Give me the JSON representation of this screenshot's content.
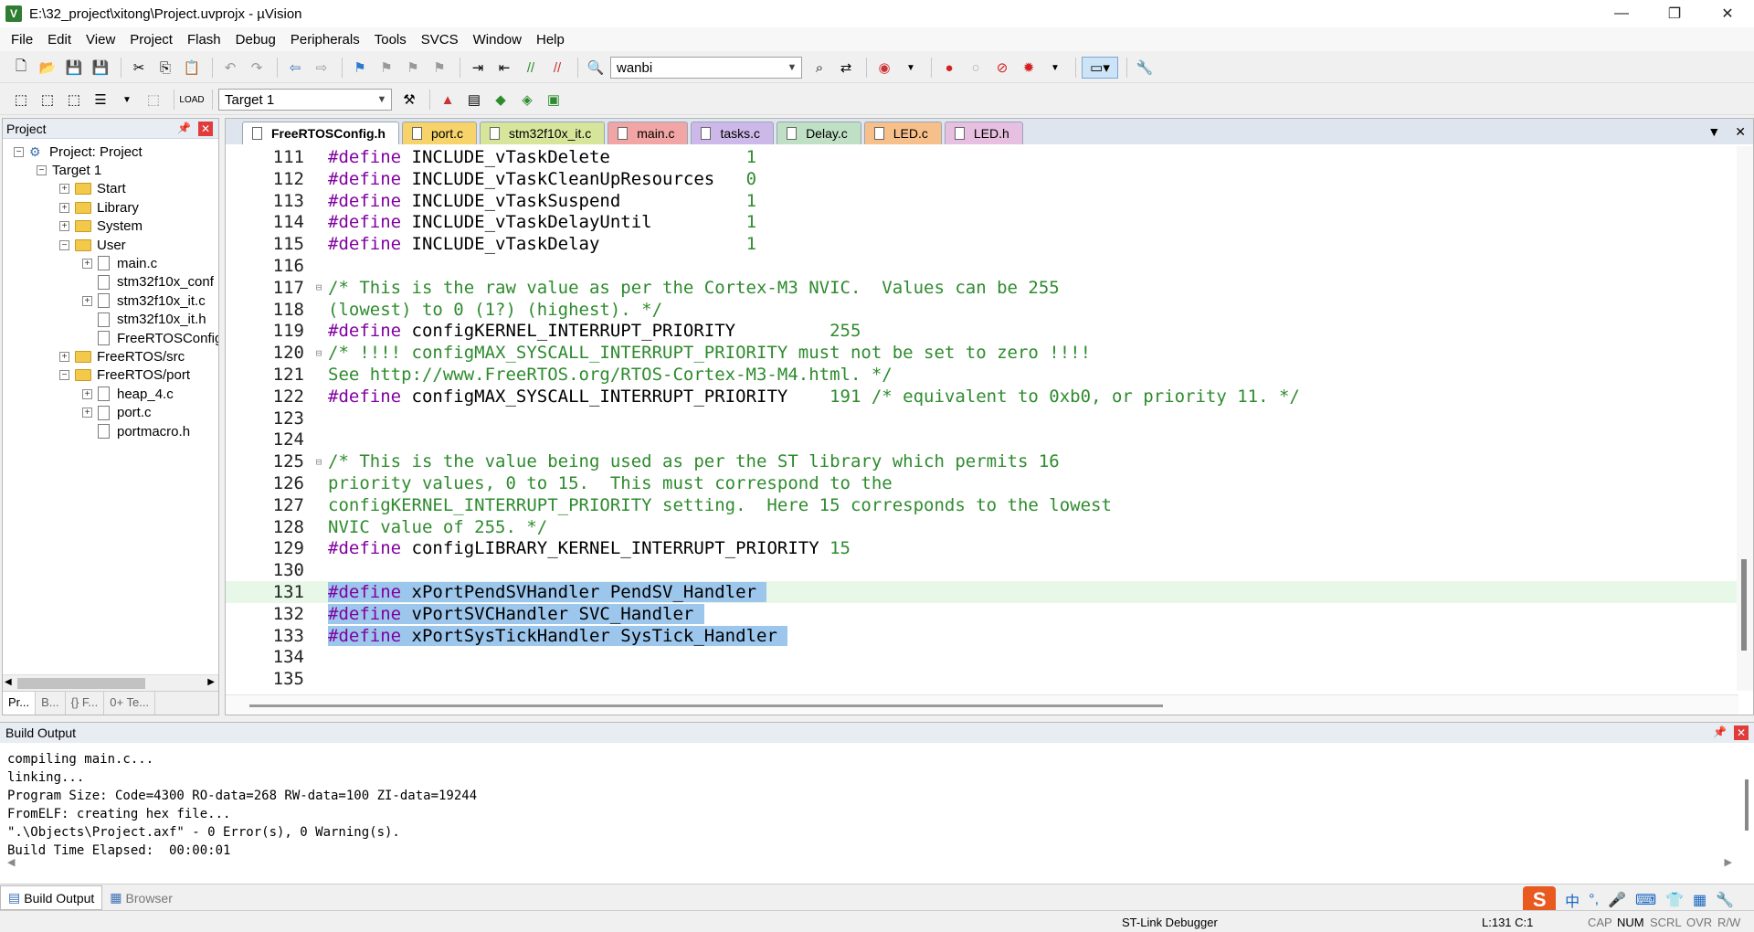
{
  "window": {
    "title": "E:\\32_project\\xitong\\Project.uvprojx - µVision",
    "minimize": "—",
    "maximize": "❐",
    "close": "✕"
  },
  "menu": [
    "File",
    "Edit",
    "View",
    "Project",
    "Flash",
    "Debug",
    "Peripherals",
    "Tools",
    "SVCS",
    "Window",
    "Help"
  ],
  "toolbar": {
    "find_value": "wanbi",
    "target_value": "Target 1"
  },
  "project_panel": {
    "title": "Project",
    "nodes": [
      {
        "label": "Project: Project",
        "level": 0,
        "type": "project",
        "exp": "−"
      },
      {
        "label": "Target 1",
        "level": 1,
        "type": "target",
        "exp": "−"
      },
      {
        "label": "Start",
        "level": 2,
        "type": "folder",
        "exp": "+"
      },
      {
        "label": "Library",
        "level": 2,
        "type": "folder",
        "exp": "+"
      },
      {
        "label": "System",
        "level": 2,
        "type": "folder",
        "exp": "+"
      },
      {
        "label": "User",
        "level": 2,
        "type": "folder",
        "exp": "−"
      },
      {
        "label": "main.c",
        "level": 3,
        "type": "file",
        "exp": "+"
      },
      {
        "label": "stm32f10x_conf",
        "level": 3,
        "type": "file",
        "exp": ""
      },
      {
        "label": "stm32f10x_it.c",
        "level": 3,
        "type": "file",
        "exp": "+"
      },
      {
        "label": "stm32f10x_it.h",
        "level": 3,
        "type": "file",
        "exp": ""
      },
      {
        "label": "FreeRTOSConfig",
        "level": 3,
        "type": "file",
        "exp": ""
      },
      {
        "label": "FreeRTOS/src",
        "level": 2,
        "type": "folder",
        "exp": "+"
      },
      {
        "label": "FreeRTOS/port",
        "level": 2,
        "type": "folder",
        "exp": "−"
      },
      {
        "label": "heap_4.c",
        "level": 3,
        "type": "file",
        "exp": "+"
      },
      {
        "label": "port.c",
        "level": 3,
        "type": "file",
        "exp": "+"
      },
      {
        "label": "portmacro.h",
        "level": 3,
        "type": "file",
        "exp": ""
      }
    ],
    "tabs": [
      "Pr...",
      "B...",
      "{} F...",
      "0+ Te..."
    ]
  },
  "editor": {
    "tabs": [
      {
        "label": "FreeRTOSConfig.h",
        "color": "#ffffff",
        "active": true
      },
      {
        "label": "port.c",
        "color": "#f6d36b",
        "active": false
      },
      {
        "label": "stm32f10x_it.c",
        "color": "#d7e59a",
        "active": false
      },
      {
        "label": "main.c",
        "color": "#f2a5a5",
        "active": false
      },
      {
        "label": "tasks.c",
        "color": "#cdb8ea",
        "active": false
      },
      {
        "label": "Delay.c",
        "color": "#bfe0c5",
        "active": false
      },
      {
        "label": "LED.c",
        "color": "#f7c08a",
        "active": false
      },
      {
        "label": "LED.h",
        "color": "#e7bfe0",
        "active": false
      }
    ],
    "lines": [
      {
        "n": "111",
        "parts": [
          {
            "t": "#define",
            "c": "pp"
          },
          {
            "t": " INCLUDE_vTaskDelete             ",
            "c": ""
          },
          {
            "t": "1",
            "c": "num"
          }
        ]
      },
      {
        "n": "112",
        "parts": [
          {
            "t": "#define",
            "c": "pp"
          },
          {
            "t": " INCLUDE_vTaskCleanUpResources   ",
            "c": ""
          },
          {
            "t": "0",
            "c": "num"
          }
        ]
      },
      {
        "n": "113",
        "parts": [
          {
            "t": "#define",
            "c": "pp"
          },
          {
            "t": " INCLUDE_vTaskSuspend            ",
            "c": ""
          },
          {
            "t": "1",
            "c": "num"
          }
        ]
      },
      {
        "n": "114",
        "parts": [
          {
            "t": "#define",
            "c": "pp"
          },
          {
            "t": " INCLUDE_vTaskDelayUntil         ",
            "c": ""
          },
          {
            "t": "1",
            "c": "num"
          }
        ]
      },
      {
        "n": "115",
        "parts": [
          {
            "t": "#define",
            "c": "pp"
          },
          {
            "t": " INCLUDE_vTaskDelay              ",
            "c": ""
          },
          {
            "t": "1",
            "c": "num"
          }
        ]
      },
      {
        "n": "116",
        "parts": []
      },
      {
        "n": "117",
        "fold": "⊟",
        "parts": [
          {
            "t": "/* This is the raw value as per the Cortex-M3 NVIC.  Values can be 255",
            "c": "cm"
          }
        ]
      },
      {
        "n": "118",
        "parts": [
          {
            "t": "(lowest) to 0 (1?) (highest). */",
            "c": "cm"
          }
        ]
      },
      {
        "n": "119",
        "parts": [
          {
            "t": "#define",
            "c": "pp"
          },
          {
            "t": " configKERNEL_INTERRUPT_PRIORITY         ",
            "c": ""
          },
          {
            "t": "255",
            "c": "num"
          }
        ]
      },
      {
        "n": "120",
        "fold": "⊟",
        "parts": [
          {
            "t": "/* !!!! configMAX_SYSCALL_INTERRUPT_PRIORITY must not be set to zero !!!!",
            "c": "cm"
          }
        ]
      },
      {
        "n": "121",
        "parts": [
          {
            "t": "See http://www.FreeRTOS.org/RTOS-Cortex-M3-M4.html. */",
            "c": "cm"
          }
        ]
      },
      {
        "n": "122",
        "parts": [
          {
            "t": "#define",
            "c": "pp"
          },
          {
            "t": " configMAX_SYSCALL_INTERRUPT_PRIORITY    ",
            "c": ""
          },
          {
            "t": "191",
            "c": "num"
          },
          {
            "t": " /* equivalent to 0xb0, or priority 11. */",
            "c": "cm"
          }
        ]
      },
      {
        "n": "123",
        "parts": []
      },
      {
        "n": "124",
        "parts": []
      },
      {
        "n": "125",
        "fold": "⊟",
        "parts": [
          {
            "t": "/* This is the value being used as per the ST library which permits 16",
            "c": "cm"
          }
        ]
      },
      {
        "n": "126",
        "parts": [
          {
            "t": "priority values, 0 to 15.  This must correspond to the",
            "c": "cm"
          }
        ]
      },
      {
        "n": "127",
        "parts": [
          {
            "t": "configKERNEL_INTERRUPT_PRIORITY setting.  Here 15 corresponds to the lowest",
            "c": "cm"
          }
        ]
      },
      {
        "n": "128",
        "parts": [
          {
            "t": "NVIC value of 255. */",
            "c": "cm"
          }
        ]
      },
      {
        "n": "129",
        "parts": [
          {
            "t": "#define",
            "c": "pp"
          },
          {
            "t": " configLIBRARY_KERNEL_INTERRUPT_PRIORITY ",
            "c": ""
          },
          {
            "t": "15",
            "c": "num"
          }
        ]
      },
      {
        "n": "130",
        "parts": []
      },
      {
        "n": "131",
        "cur": true,
        "sel": true,
        "parts": [
          {
            "t": "#define",
            "c": "pp"
          },
          {
            "t": " xPortPendSVHandler PendSV_Handler ",
            "c": ""
          }
        ]
      },
      {
        "n": "132",
        "sel": true,
        "parts": [
          {
            "t": "#define",
            "c": "pp"
          },
          {
            "t": " vPortSVCHandler SVC_Handler ",
            "c": ""
          }
        ]
      },
      {
        "n": "133",
        "sel": true,
        "parts": [
          {
            "t": "#define",
            "c": "pp"
          },
          {
            "t": " xPortSysTickHandler SysTick_Handler ",
            "c": ""
          }
        ]
      },
      {
        "n": "134",
        "parts": []
      },
      {
        "n": "135",
        "parts": []
      }
    ]
  },
  "build_output": {
    "title": "Build Output",
    "lines": [
      "compiling main.c...",
      "linking...",
      "Program Size: Code=4300 RO-data=268 RW-data=100 ZI-data=19244",
      "FromELF: creating hex file...",
      "\".\\Objects\\Project.axf\" - 0 Error(s), 0 Warning(s).",
      "Build Time Elapsed:  00:00:01"
    ],
    "tabs": [
      "Build Output",
      "Browser"
    ]
  },
  "ime": {
    "logo": "S",
    "lang": "中",
    "items": [
      "°,",
      "🎤",
      "⌨",
      "👕",
      "▦",
      "🔧"
    ]
  },
  "status": {
    "debugger": "ST-Link Debugger",
    "position": "L:131 C:1",
    "caps": "CAP",
    "num": "NUM",
    "scrl": "SCRL",
    "ovr": "OVR",
    "rw": "R/W"
  }
}
